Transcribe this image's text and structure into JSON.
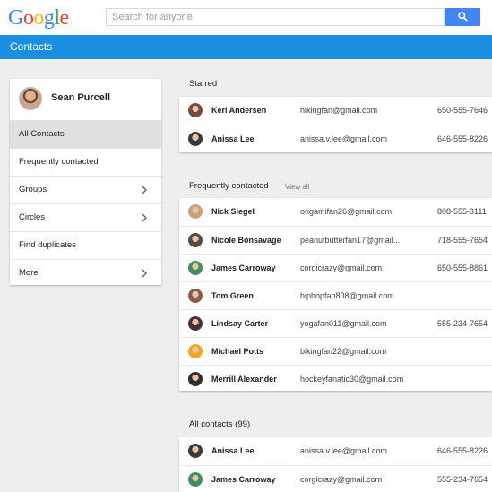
{
  "logo": {
    "letters": [
      "G",
      "o",
      "o",
      "g",
      "l",
      "e"
    ],
    "colors": [
      "#4285f4",
      "#ea4335",
      "#fbbc05",
      "#4285f4",
      "#34a853",
      "#ea4335"
    ]
  },
  "search": {
    "placeholder": "Search for anyone"
  },
  "appbar": {
    "title": "Contacts",
    "color": "#1a8ee1"
  },
  "profile": {
    "name": "Sean Purcell"
  },
  "menu": [
    {
      "label": "All Contacts",
      "active": true,
      "chevron": false
    },
    {
      "label": "Frequently contacted",
      "active": false,
      "chevron": false
    },
    {
      "label": "Groups",
      "active": false,
      "chevron": true
    },
    {
      "label": "Circles",
      "active": false,
      "chevron": true
    },
    {
      "label": "Find duplicates",
      "active": false,
      "chevron": false
    },
    {
      "label": "More",
      "active": false,
      "chevron": true
    }
  ],
  "sections": {
    "starred": {
      "title": "Starred",
      "rows": [
        {
          "name": "Keri Andersen",
          "email": "hikingfan@gmail.com",
          "phone": "650-555-7646",
          "avatar": "#7a4a3a"
        },
        {
          "name": "Anissa Lee",
          "email": "anissa.v.lee@gmail.com",
          "phone": "646-555-8226",
          "avatar": "#3a3a3a"
        }
      ]
    },
    "frequent": {
      "title": "Frequently contacted",
      "view_all": "View all",
      "rows": [
        {
          "name": "Nick Siegel",
          "email": "origamifan26@gmail.com",
          "phone": "808-555-3111",
          "avatar": "#c9a27a"
        },
        {
          "name": "Nicole Bonsavage",
          "email": "peanutbutterfan17@gmail...",
          "phone": "718-555-7654",
          "avatar": "#5a4a40"
        },
        {
          "name": "James Carroway",
          "email": "corgicrazy@gmail.com",
          "phone": "650-555-8861",
          "avatar": "#3f8f5a"
        },
        {
          "name": "Tom Green",
          "email": "hiphopfan808@gmail.com",
          "phone": "",
          "avatar": "#8a5a4a"
        },
        {
          "name": "Lindsay Carter",
          "email": "yogafan011@gmail.com",
          "phone": "555-234-7654",
          "avatar": "#4a2f3a"
        },
        {
          "name": "Michael Potts",
          "email": "bikingfan22@gmail.com",
          "phone": "",
          "avatar": "#f2a81f"
        },
        {
          "name": "Merrill Alexander",
          "email": "hockeyfanatic30@gmail.com",
          "phone": "",
          "avatar": "#2f2f2f"
        }
      ]
    },
    "all": {
      "title": "All contacts (99)",
      "rows": [
        {
          "name": "Anissa Lee",
          "email": "anissa.v.lee@gmail.com",
          "phone": "646-555-8226",
          "avatar": "#3a3a3a"
        },
        {
          "name": "James Carroway",
          "email": "corgicrazy@gmail.com",
          "phone": "555-234-7654",
          "avatar": "#3f8f5a"
        }
      ]
    }
  }
}
